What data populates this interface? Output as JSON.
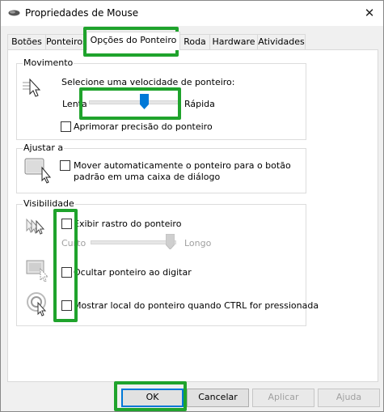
{
  "window": {
    "title": "Propriedades de Mouse",
    "close_icon": "close-icon"
  },
  "tabs": [
    {
      "label": "Botões"
    },
    {
      "label": "Ponteiros"
    },
    {
      "label": "Opções do Ponteiro",
      "active": true
    },
    {
      "label": "Roda"
    },
    {
      "label": "Hardware"
    },
    {
      "label": "Atividades"
    }
  ],
  "movimento": {
    "title": "Movimento",
    "prompt": "Selecione uma velocidade de ponteiro:",
    "slow_label": "Lenta",
    "fast_label": "Rápida",
    "speed_level": 0.65,
    "enhance_label": "Aprimorar precisão do ponteiro",
    "enhance_checked": false
  },
  "ajustar": {
    "title": "Ajustar a",
    "snap_label_line1": "Mover automaticamente o ponteiro para o botão",
    "snap_label_line2": "padrão em uma caixa de diálogo",
    "snap_checked": false
  },
  "visibilidade": {
    "title": "Visibilidade",
    "trails_label": "Exibir rastro do ponteiro",
    "trails_checked": false,
    "short_label": "Curto",
    "long_label": "Longo",
    "trail_length_level": 1.0,
    "hide_label": "Ocultar ponteiro ao digitar",
    "hide_checked": false,
    "ctrl_label": "Mostrar local do ponteiro quando CTRL for pressionada",
    "ctrl_checked": false
  },
  "buttons": {
    "ok": "OK",
    "cancel": "Cancelar",
    "apply": "Aplicar",
    "help": "Ajuda"
  },
  "colors": {
    "highlight": "#1fa32c",
    "accent": "#0078d7"
  }
}
